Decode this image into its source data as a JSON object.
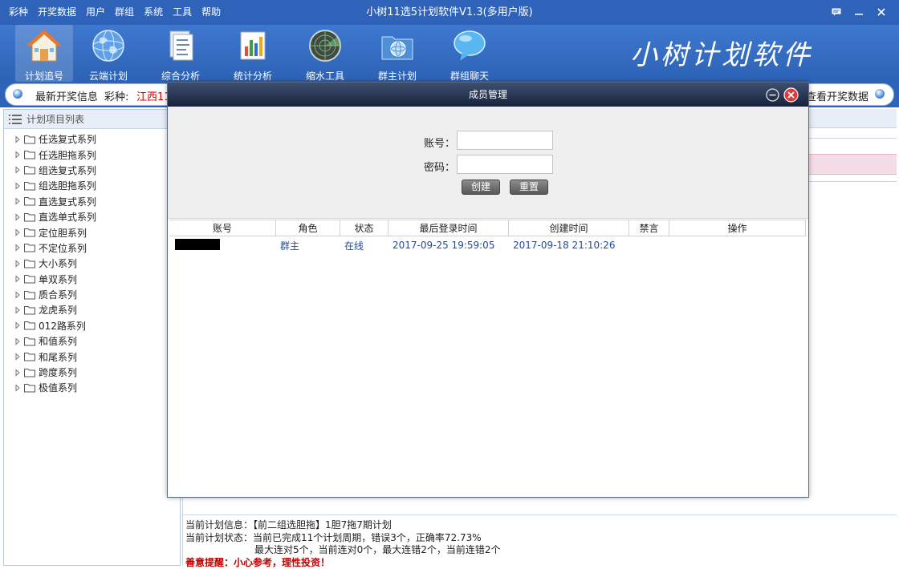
{
  "window": {
    "title": "小树11选5计划软件V1.3(多用户版)",
    "menu": [
      "彩种",
      "开奖数据",
      "用户",
      "群组",
      "系统",
      "工具",
      "帮助"
    ],
    "controls": [
      "feedback-icon",
      "minimize-icon",
      "close-icon"
    ]
  },
  "toolbar": {
    "items": [
      {
        "label": "计划追号",
        "icon": "house-icon",
        "active": true
      },
      {
        "label": "云端计划",
        "icon": "globe-icon",
        "active": false
      },
      {
        "label": "综合分析",
        "icon": "document-icon",
        "active": false
      },
      {
        "label": "统计分析",
        "icon": "bar-chart-icon",
        "active": false
      },
      {
        "label": "缩水工具",
        "icon": "radar-icon",
        "active": false
      },
      {
        "label": "群主计划",
        "icon": "folder-globe-icon",
        "active": false
      },
      {
        "label": "群组聊天",
        "icon": "chat-bubble-icon",
        "active": false
      }
    ],
    "brand": "小树计划软件"
  },
  "infobar": {
    "title": "最新开奖信息",
    "caizhong_label": "彩种:",
    "caizhong_value": "江西11",
    "view_data": "查看开奖数据"
  },
  "left_panel": {
    "header": "计划项目列表",
    "items": [
      "任选复式系列",
      "任选胆拖系列",
      "组选复式系列",
      "组选胆拖系列",
      "直选复式系列",
      "直选单式系列",
      "定位胆系列",
      "不定位系列",
      "大小系列",
      "单双系列",
      "质合系列",
      "龙虎系列",
      "012路系列",
      "和值系列",
      "和尾系列",
      "跨度系列",
      "极值系列"
    ]
  },
  "plan_info": {
    "line1": "当前计划信息：【前二组选胆拖】1胆7拖7期计划",
    "line2": "当前计划状态：当前已完成11个计划周期，错误3个，正确率72.73%",
    "line3": "最大连对5个，当前连对0个，最大连错2个，当前连错2个",
    "warning": "善意提醒：小心参考，理性投资！"
  },
  "modal": {
    "title": "成员管理",
    "account_label": "账号：",
    "password_label": "密码：",
    "account_value": "",
    "password_value": "",
    "create_btn": "创建",
    "reset_btn": "重置",
    "columns": [
      "账号",
      "角色",
      "状态",
      "最后登录时间",
      "创建时间",
      "禁言",
      "操作"
    ],
    "rows": [
      {
        "account": "",
        "role": "群主",
        "status": "在线",
        "last_login": "2017-09-25 19:59:05",
        "created": "2017-09-18 21:10:26",
        "muted": "",
        "actions": ""
      }
    ]
  }
}
